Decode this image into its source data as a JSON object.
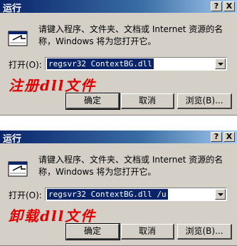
{
  "dialogs": [
    {
      "title": "运行",
      "help_btn": "?",
      "close_btn": "X",
      "description": "请键入程序、文件夹、文档或 Internet 资源的名称，Windows 将为您打开它。",
      "open_label": "打开(O):",
      "command": "regsvr32 ContextBG.dll",
      "caption": "注册dll文件",
      "ok_label": "确定",
      "cancel_label": "取消",
      "browse_label": "浏览(B)..."
    },
    {
      "title": "运行",
      "help_btn": "?",
      "close_btn": "X",
      "description": "请键入程序、文件夹、文档或 Internet 资源的名称，Windows 将为您打开它。",
      "open_label": "打开(O):",
      "command": "regsvr32 ContextBG.dll /u",
      "caption": "卸载dll文件",
      "ok_label": "确定",
      "cancel_label": "取消",
      "browse_label": "浏览(B)..."
    }
  ],
  "colors": {
    "titlebar": "#0a246a",
    "caption": "#e00000"
  },
  "icons": [
    "run-icon",
    "dropdown-arrow-icon"
  ]
}
